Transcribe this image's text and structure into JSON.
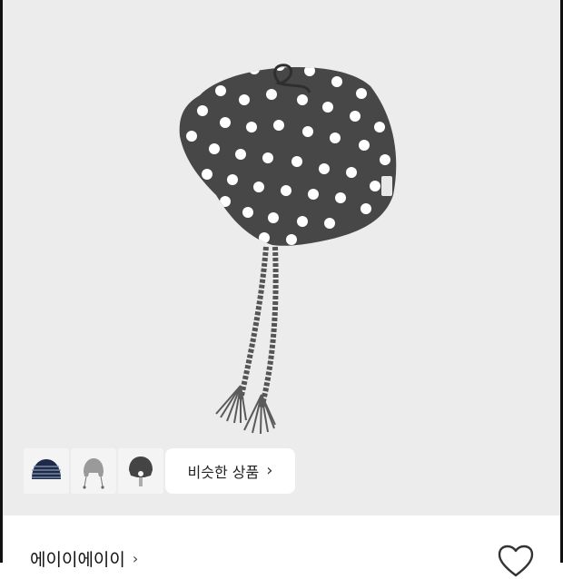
{
  "similar_button": {
    "label": "비슷한 상품",
    "chevron": "›"
  },
  "brand": {
    "name": "에이이에이이",
    "chevron": "›"
  },
  "icons": {
    "wishlist": "heart-outline-icon",
    "brand_link": "chevron-right-icon"
  },
  "colors": {
    "background": "#ececec",
    "hat": "#474747",
    "dots": "#ffffff"
  }
}
